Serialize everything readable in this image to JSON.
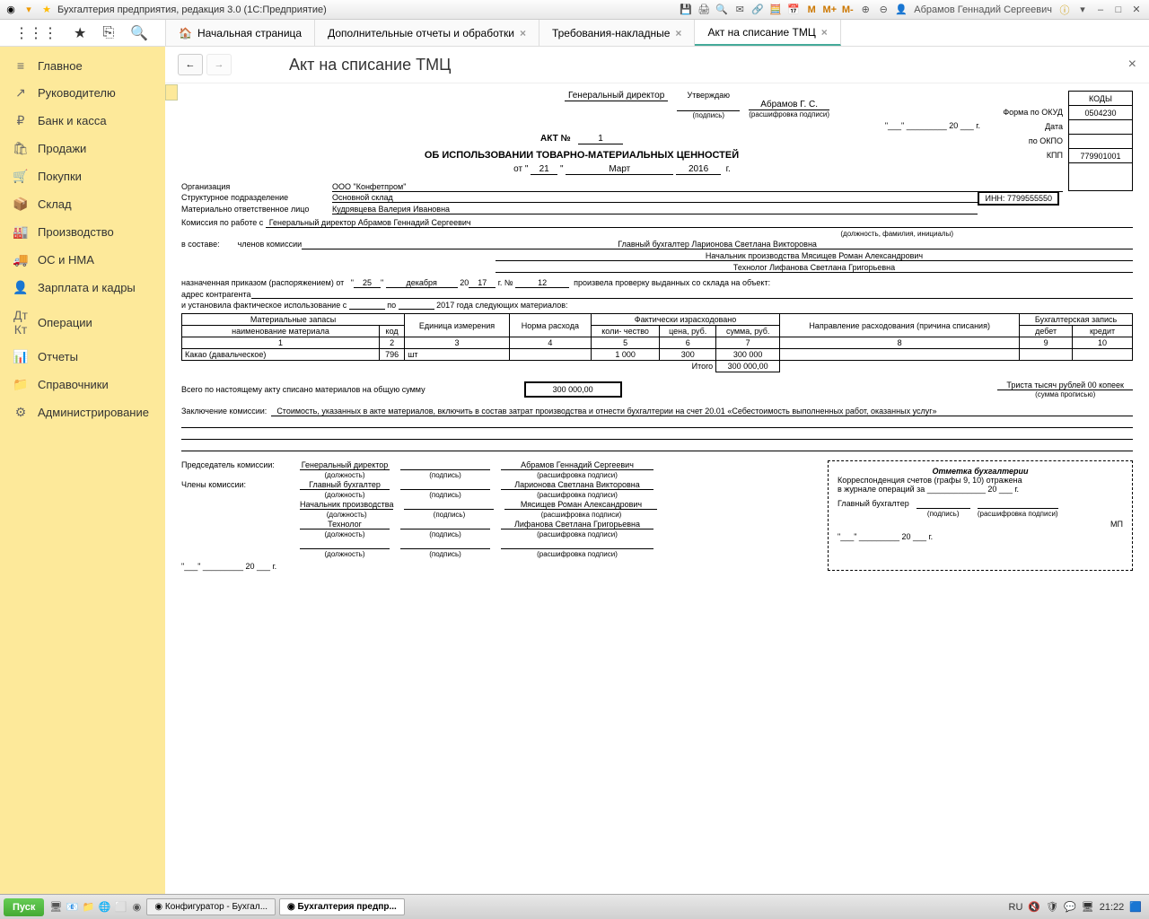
{
  "titlebar": {
    "app_title": "Бухгалтерия предприятия, редакция 3.0  (1С:Предприятие)",
    "user": "Абрамов Геннадий Сергеевич"
  },
  "tabs": {
    "home": "Начальная страница",
    "reports": "Дополнительные отчеты и обработки",
    "req": "Требования-накладные",
    "act": "Акт на списание ТМЦ"
  },
  "sidebar": {
    "main": "Главное",
    "manager": "Руководителю",
    "bank": "Банк и касса",
    "sales": "Продажи",
    "purch": "Покупки",
    "stock": "Склад",
    "prod": "Производство",
    "os": "ОС и НМА",
    "salary": "Зарплата и кадры",
    "ops": "Операции",
    "reports": "Отчеты",
    "refs": "Справочники",
    "admin": "Администрирование"
  },
  "page": {
    "title": "Акт на списание ТМЦ"
  },
  "approve": {
    "title": "Утверждаю",
    "gendir_label": "Генеральный директор",
    "sign_sub": "(подпись)",
    "decode_sub": "(расшифровка подписи)",
    "name": "Абрамов Г. С.",
    "year_suffix": "20 ___ г."
  },
  "act": {
    "no_label": "АКТ №",
    "no": "1",
    "heading": "ОБ ИСПОЛЬЗОВАНИИ ТОВАРНО-МАТЕРИАЛЬНЫХ ЦЕННОСТЕЙ",
    "from": "от",
    "day": "21",
    "month": "Март",
    "year": "2016",
    "g": "г."
  },
  "codes": {
    "header": "КОДЫ",
    "okud_label": "Форма по ОКУД",
    "okud": "0504230",
    "date_label": "Дата",
    "okpo_label": "по ОКПО",
    "kpp_label": "КПП",
    "kpp": "779901001",
    "inn": "ИНН: 7799555550"
  },
  "org": {
    "label": "Организация",
    "value": "ООО \"Конфетпром\"",
    "dept_label": "Структурное подразделение",
    "dept": "Основной склад",
    "mol_label": "Материально ответственное лицо",
    "mol": "Кудрявцева Валерия Ивановна"
  },
  "commission": {
    "head_label": "Комиссия по работе с",
    "head": "Генеральный директор  Абрамов Геннадий Сергеевич",
    "pos_sub": "(должность, фамилия, инициалы)",
    "composition_label": "в составе:",
    "members_label": "членов комиссии",
    "m1": "Главный бухгалтер  Ларионова Светлана Викторовна",
    "m2": "Начальник производства  Мясищев Роман Александрович",
    "m3": "Технолог Лифанова Светлана Григорьевна",
    "order_prefix": "назначенная приказом (распоряжением) от",
    "order_day": "25",
    "order_month": "декабря",
    "order_year_prefix": "20",
    "order_year": "17",
    "order_no_label": "г.   №",
    "order_no": "12",
    "order_suffix": "произвела проверку выданных со склада на объект:",
    "addr_label": "адрес контрагента",
    "fact_label": "и установила фактическое использование с",
    "po": "по",
    "fact_suffix": "2017 года следующих материалов:"
  },
  "table": {
    "h_mat": "Материальные запасы",
    "h_unit": "Единица измерения",
    "h_norm": "Норма расхода",
    "h_fact": "Фактически израсходовано",
    "h_dir": "Направление расходования (причина списания)",
    "h_acc": "Бухгалтерская запись",
    "h_name": "наименование материала",
    "h_code": "код",
    "h_qty": "коли-\nчество",
    "h_price": "цена, руб.",
    "h_sum": "сумма, руб.",
    "h_debit": "дебет",
    "h_credit": "кредит",
    "c1": "1",
    "c2": "2",
    "c3": "3",
    "c4": "4",
    "c5": "5",
    "c6": "6",
    "c7": "7",
    "c8": "8",
    "c9": "9",
    "c10": "10",
    "row1_name": "Какао (давальческое)",
    "row1_code": "796",
    "row1_unit": "шт",
    "row1_qty": "1 000",
    "row1_price": "300",
    "row1_sum": "300 000",
    "total_label": "Итого",
    "total_sum": "300 000,00"
  },
  "totals": {
    "text": "Всего по настоящему акту списано материалов на общую сумму",
    "amount": "300 000,00",
    "words": "Триста тысяч рублей 00 копеек",
    "words_sub": "(сумма прописью)"
  },
  "conclusion": {
    "label": "Заключение комиссии:",
    "text": "Стоимость, указанных в акте материалов, включить в состав затрат производства и отнести бухгалтерии на счет 20.01 «Себестоимость выполненных работ, оказанных услуг»"
  },
  "sign": {
    "chair_label": "Председатель комиссии:",
    "members_label": "Члены комиссии:",
    "pos_sub": "(должность)",
    "sign_sub": "(подпись)",
    "decode_sub": "(расшифровка подписи)",
    "p1_pos": "Генеральный директор",
    "p1_name": "Абрамов Геннадий Сергеевич",
    "p2_pos": "Главный бухгалтер",
    "p2_name": "Ларионова Светлана Викторовна",
    "p3_pos": "Начальник производства",
    "p3_name": "Мясищев Роман Александрович",
    "p4_pos": "Технолог",
    "p4_name": "Лифанова Светлана Григорьевна",
    "date_stub": "\"___\" _________ 20 ___ г."
  },
  "accounting": {
    "title": "Отметка бухгалтерии",
    "line1": "Корреспонденция счетов (графы 9, 10) отражена",
    "line2_a": "в журнале операций за _____________ 20 ___   г.",
    "chief": "Главный бухгалтер",
    "sign_sub": "(подпись)",
    "decode_sub": "(расшифровка подписи)",
    "mp": "МП",
    "date_stub": "\"___\" _________ 20 ___ г."
  },
  "taskbar": {
    "start": "Пуск",
    "t1": "Конфигуратор - Бухгал...",
    "t2": "Бухгалтерия предпр...",
    "lang": "RU",
    "time": "21:22"
  }
}
